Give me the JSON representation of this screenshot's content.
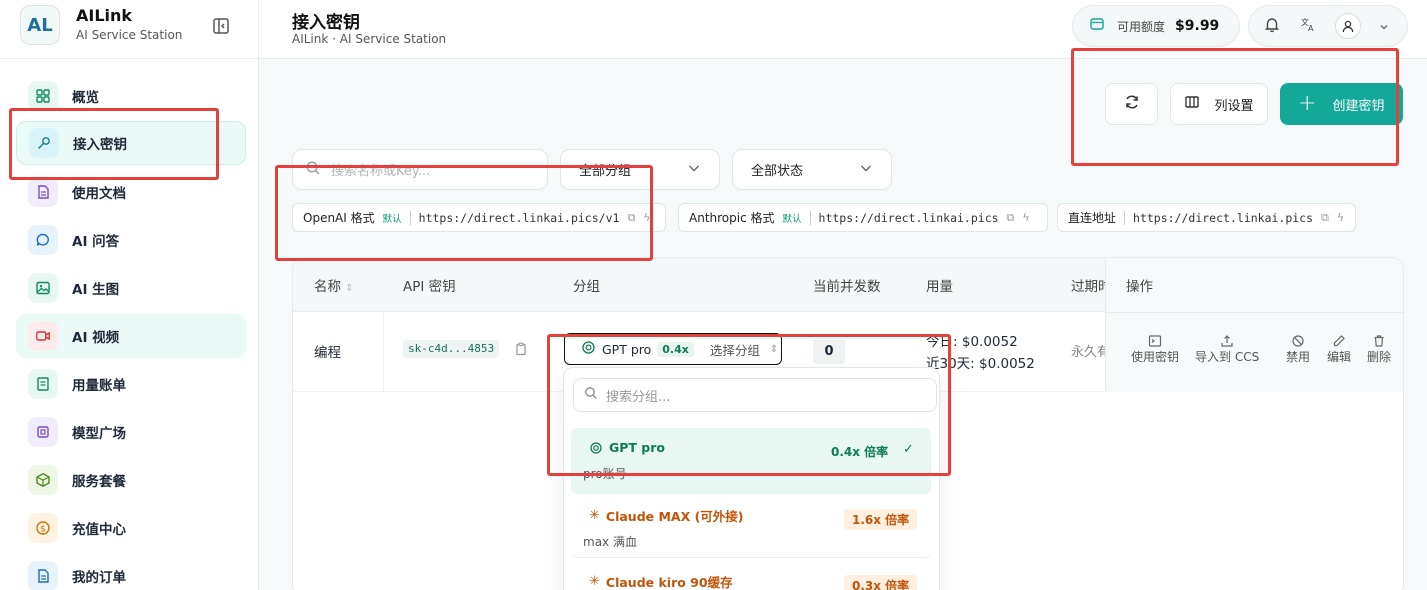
{
  "brand": {
    "logo_text": "AL",
    "name": "AILink",
    "subtitle": "AI Service Station"
  },
  "sidebar": {
    "items": [
      {
        "label": "概览",
        "icon": "dashboard-icon"
      },
      {
        "label": "接入密钥",
        "icon": "key-icon"
      },
      {
        "label": "使用文档",
        "icon": "document-icon"
      },
      {
        "label": "AI 问答",
        "icon": "chat-icon"
      },
      {
        "label": "AI 生图",
        "icon": "image-icon"
      },
      {
        "label": "AI 视频",
        "icon": "video-icon"
      },
      {
        "label": "用量账单",
        "icon": "bill-icon"
      },
      {
        "label": "模型广场",
        "icon": "model-icon"
      },
      {
        "label": "服务套餐",
        "icon": "package-icon"
      },
      {
        "label": "充值中心",
        "icon": "recharge-icon"
      },
      {
        "label": "我的订单",
        "icon": "orders-icon"
      }
    ]
  },
  "header": {
    "title": "接入密钥",
    "subtitle": "AILink · AI Service Station",
    "credit_label": "可用额度",
    "credit_value": "$9.99"
  },
  "toolbar": {
    "refresh_icon": "refresh-icon",
    "columns_label": "列设置",
    "create_label": "创建密钥"
  },
  "filters": {
    "search_placeholder": "搜索名称或Key...",
    "group_select": "全部分组",
    "status_select": "全部状态"
  },
  "endpoints": [
    {
      "label": "OpenAI 格式",
      "tag": "默认",
      "url": "https://direct.linkai.pics/v1"
    },
    {
      "label": "Anthropic 格式",
      "tag": "默认",
      "url": "https://direct.linkai.pics"
    },
    {
      "label": "直连地址",
      "tag": "",
      "url": "https://direct.linkai.pics"
    }
  ],
  "table": {
    "headers": {
      "name": "名称",
      "key": "API 密钥",
      "group": "分组",
      "concurrency": "当前并发数",
      "usage": "用量",
      "expire": "过期时",
      "actions": "操作"
    },
    "row": {
      "name": "编程",
      "key": "sk-c4d...4853",
      "group_name": "GPT pro",
      "group_mult": "0.4x",
      "group_select": "选择分组",
      "concurrency": "0",
      "usage_today_label": "今日:",
      "usage_today": "$0.0052",
      "usage_30_label": "近30天:",
      "usage_30": "$0.0052",
      "expire": "永久有",
      "actions": [
        "使用密钥",
        "导入到 CCS",
        "禁用",
        "编辑",
        "删除"
      ]
    }
  },
  "dropdown": {
    "search_placeholder": "搜索分组...",
    "items": [
      {
        "name": "GPT pro",
        "desc": "pro账号",
        "mult": "0.4x 倍率",
        "selected": true,
        "color": "#0d7a56"
      },
      {
        "name": "Claude MAX (可外接)",
        "desc": "max 满血",
        "mult": "1.6x 倍率",
        "selected": false,
        "color": "#c2540a"
      },
      {
        "name": "Claude kiro 90缓存",
        "desc": "",
        "mult": "0.3x 倍率",
        "selected": false,
        "color": "#c2540a"
      }
    ]
  },
  "colors": {
    "accent": "#13a897",
    "highlight_red": "#e5413c"
  }
}
